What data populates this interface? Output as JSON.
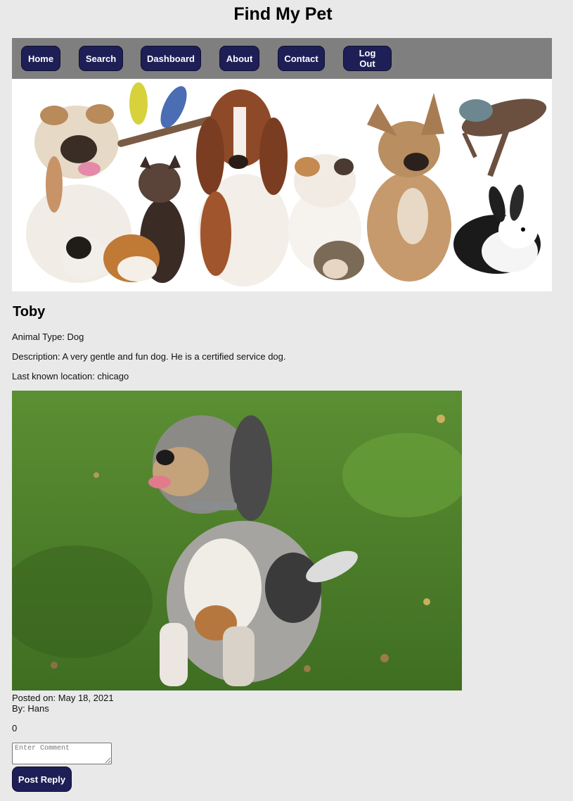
{
  "site": {
    "title": "Find My Pet"
  },
  "nav": {
    "items": [
      {
        "label": "Home"
      },
      {
        "label": "Search"
      },
      {
        "label": "Dashboard"
      },
      {
        "label": "About"
      },
      {
        "label": "Contact"
      },
      {
        "label": "Log Out"
      }
    ]
  },
  "banner": {
    "animals": [
      "bulldog-icon",
      "parakeets-icon",
      "basset-hound-icon",
      "kitten-icon",
      "guinea-pigs-icon",
      "persian-cat-icon",
      "hedgehog-icon",
      "french-bulldog-icon",
      "iguana-icon",
      "rabbit-icon"
    ]
  },
  "pet": {
    "name": "Toby",
    "animal_type": "Animal Type: Dog",
    "description": "Description: A very gentle and fun dog. He is a certified service dog.",
    "location": "Last known location: chicago",
    "posted_on": "Posted on: May 18, 2021",
    "posted_by": "By: Hans",
    "likes": "0"
  },
  "comment": {
    "placeholder": "Enter Comment",
    "submit_label": "Post Reply"
  },
  "colors": {
    "page_bg": "#e9e9e9",
    "nav_bg": "#7f7f7f",
    "button_bg": "#1f1f57",
    "grass": "#4c7d2a"
  }
}
